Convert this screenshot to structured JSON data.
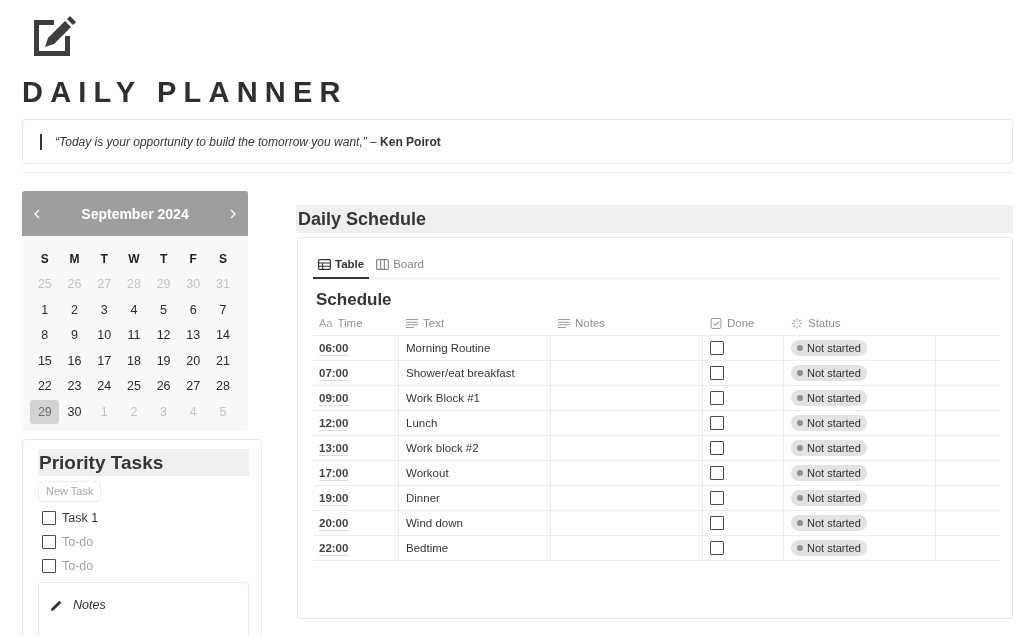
{
  "page": {
    "title": "DAILY PLANNER",
    "quote": "*“Today is your opportunity to build the tomorrow you want,”* – **Ken Poirot**"
  },
  "calendar": {
    "month": "September 2024",
    "weekdays": [
      "S",
      "M",
      "T",
      "W",
      "T",
      "F",
      "S"
    ],
    "days": [
      {
        "day": "25",
        "in_month": false,
        "selected": false
      },
      {
        "day": "26",
        "in_month": false,
        "selected": false
      },
      {
        "day": "27",
        "in_month": false,
        "selected": false
      },
      {
        "day": "28",
        "in_month": false,
        "selected": false
      },
      {
        "day": "29",
        "in_month": false,
        "selected": false
      },
      {
        "day": "30",
        "in_month": false,
        "selected": false
      },
      {
        "day": "31",
        "in_month": false,
        "selected": false
      },
      {
        "day": "1",
        "in_month": true,
        "selected": false
      },
      {
        "day": "2",
        "in_month": true,
        "selected": false
      },
      {
        "day": "3",
        "in_month": true,
        "selected": false
      },
      {
        "day": "4",
        "in_month": true,
        "selected": false
      },
      {
        "day": "5",
        "in_month": true,
        "selected": false
      },
      {
        "day": "6",
        "in_month": true,
        "selected": false
      },
      {
        "day": "7",
        "in_month": true,
        "selected": false
      },
      {
        "day": "8",
        "in_month": true,
        "selected": false
      },
      {
        "day": "9",
        "in_month": true,
        "selected": false
      },
      {
        "day": "10",
        "in_month": true,
        "selected": false
      },
      {
        "day": "11",
        "in_month": true,
        "selected": false
      },
      {
        "day": "12",
        "in_month": true,
        "selected": false
      },
      {
        "day": "13",
        "in_month": true,
        "selected": false
      },
      {
        "day": "14",
        "in_month": true,
        "selected": false
      },
      {
        "day": "15",
        "in_month": true,
        "selected": false
      },
      {
        "day": "16",
        "in_month": true,
        "selected": false
      },
      {
        "day": "17",
        "in_month": true,
        "selected": false
      },
      {
        "day": "18",
        "in_month": true,
        "selected": false
      },
      {
        "day": "19",
        "in_month": true,
        "selected": false
      },
      {
        "day": "20",
        "in_month": true,
        "selected": false
      },
      {
        "day": "21",
        "in_month": true,
        "selected": false
      },
      {
        "day": "22",
        "in_month": true,
        "selected": false
      },
      {
        "day": "23",
        "in_month": true,
        "selected": false
      },
      {
        "day": "24",
        "in_month": true,
        "selected": false
      },
      {
        "day": "25",
        "in_month": true,
        "selected": false
      },
      {
        "day": "26",
        "in_month": true,
        "selected": false
      },
      {
        "day": "27",
        "in_month": true,
        "selected": false
      },
      {
        "day": "28",
        "in_month": true,
        "selected": false
      },
      {
        "day": "29",
        "in_month": true,
        "selected": true
      },
      {
        "day": "30",
        "in_month": true,
        "selected": false
      },
      {
        "day": "1",
        "in_month": false,
        "selected": false
      },
      {
        "day": "2",
        "in_month": false,
        "selected": false
      },
      {
        "day": "3",
        "in_month": false,
        "selected": false
      },
      {
        "day": "4",
        "in_month": false,
        "selected": false
      },
      {
        "day": "5",
        "in_month": false,
        "selected": false
      }
    ]
  },
  "priority_tasks": {
    "title": "Priority Tasks",
    "new_button": "New Task",
    "items": [
      {
        "text": "Task 1",
        "checked": false
      },
      {
        "placeholder": "To-do",
        "checked": false
      },
      {
        "placeholder": "To-do",
        "checked": false
      }
    ],
    "notes": {
      "title": "Notes"
    }
  },
  "schedule": {
    "title": "Daily Schedule",
    "tabs": [
      {
        "label": "Table",
        "kind": "table",
        "selected": true
      },
      {
        "label": "Board",
        "kind": "board",
        "selected": false
      }
    ],
    "table": {
      "title": "Schedule",
      "columns": [
        {
          "label": "Time",
          "kind": "title",
          "type_label": "Aa"
        },
        {
          "label": "Text",
          "kind": "text"
        },
        {
          "label": "Notes",
          "kind": "text"
        },
        {
          "label": "Done",
          "kind": "checkbox"
        },
        {
          "label": "Status",
          "kind": "status"
        }
      ],
      "rows": [
        {
          "time": "06:00",
          "text": "Morning Routine",
          "done": false,
          "status": "Not started"
        },
        {
          "time": "07:00",
          "text": "Shower/eat breakfast",
          "done": false,
          "status": "Not started"
        },
        {
          "time": "09:00",
          "text": "Work Block #1",
          "done": false,
          "status": "Not started"
        },
        {
          "time": "12:00",
          "text": "Lunch",
          "done": false,
          "status": "Not started"
        },
        {
          "time": "13:00",
          "text": "Work block #2",
          "done": false,
          "status": "Not started"
        },
        {
          "time": "17:00",
          "text": "Workout",
          "done": false,
          "status": "Not started"
        },
        {
          "time": "19:00",
          "text": "Dinner",
          "done": false,
          "status": "Not started"
        },
        {
          "time": "20:00",
          "text": "Wind down",
          "done": false,
          "status": "Not started"
        },
        {
          "time": "22:00",
          "text": "Bedtime",
          "done": false,
          "status": "Not started"
        }
      ]
    }
  }
}
